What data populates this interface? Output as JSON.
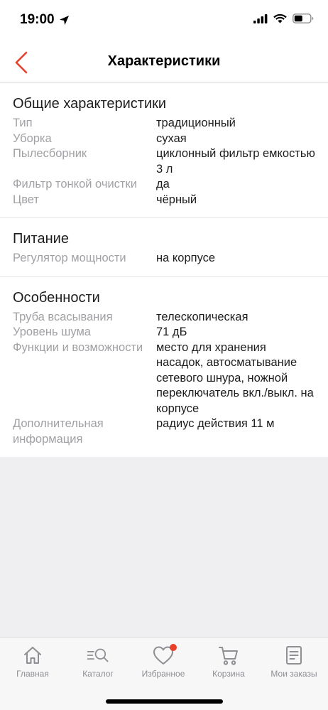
{
  "status_bar": {
    "time": "19:00"
  },
  "nav": {
    "title": "Характеристики"
  },
  "sections": [
    {
      "title": "Общие характеристики",
      "rows": [
        {
          "label": "Тип",
          "value": "традиционный"
        },
        {
          "label": "Уборка",
          "value": "сухая"
        },
        {
          "label": "Пылесборник",
          "value": "циклонный фильтр емкостью 3 л"
        },
        {
          "label": "Фильтр тонкой очистки",
          "value": "да"
        },
        {
          "label": "Цвет",
          "value": "чёрный"
        }
      ]
    },
    {
      "title": "Питание",
      "rows": [
        {
          "label": "Регулятор мощности",
          "value": "на корпусе"
        }
      ]
    },
    {
      "title": "Особенности",
      "rows": [
        {
          "label": "Труба всасывания",
          "value": "телескопическая"
        },
        {
          "label": "Уровень шума",
          "value": "71 дБ"
        },
        {
          "label": "Функции и возможности",
          "value": "место для хранения насадок, автосматывание сетевого шнура, ножной переключатель вкл./выкл. на корпусе"
        },
        {
          "label": "Дополнительная информация",
          "value": "радиус действия 11 м"
        }
      ]
    }
  ],
  "tabs": [
    {
      "label": "Главная",
      "icon": "home-icon"
    },
    {
      "label": "Каталог",
      "icon": "catalog-search-icon"
    },
    {
      "label": "Избранное",
      "icon": "heart-icon",
      "badge": true
    },
    {
      "label": "Корзина",
      "icon": "cart-icon"
    },
    {
      "label": "Мои заказы",
      "icon": "orders-icon"
    }
  ],
  "colors": {
    "accent": "#e8412b",
    "label": "#a0a0a5",
    "text": "#1d1d1f",
    "background": "#efeff1",
    "tab_inactive": "#8e8e93"
  }
}
